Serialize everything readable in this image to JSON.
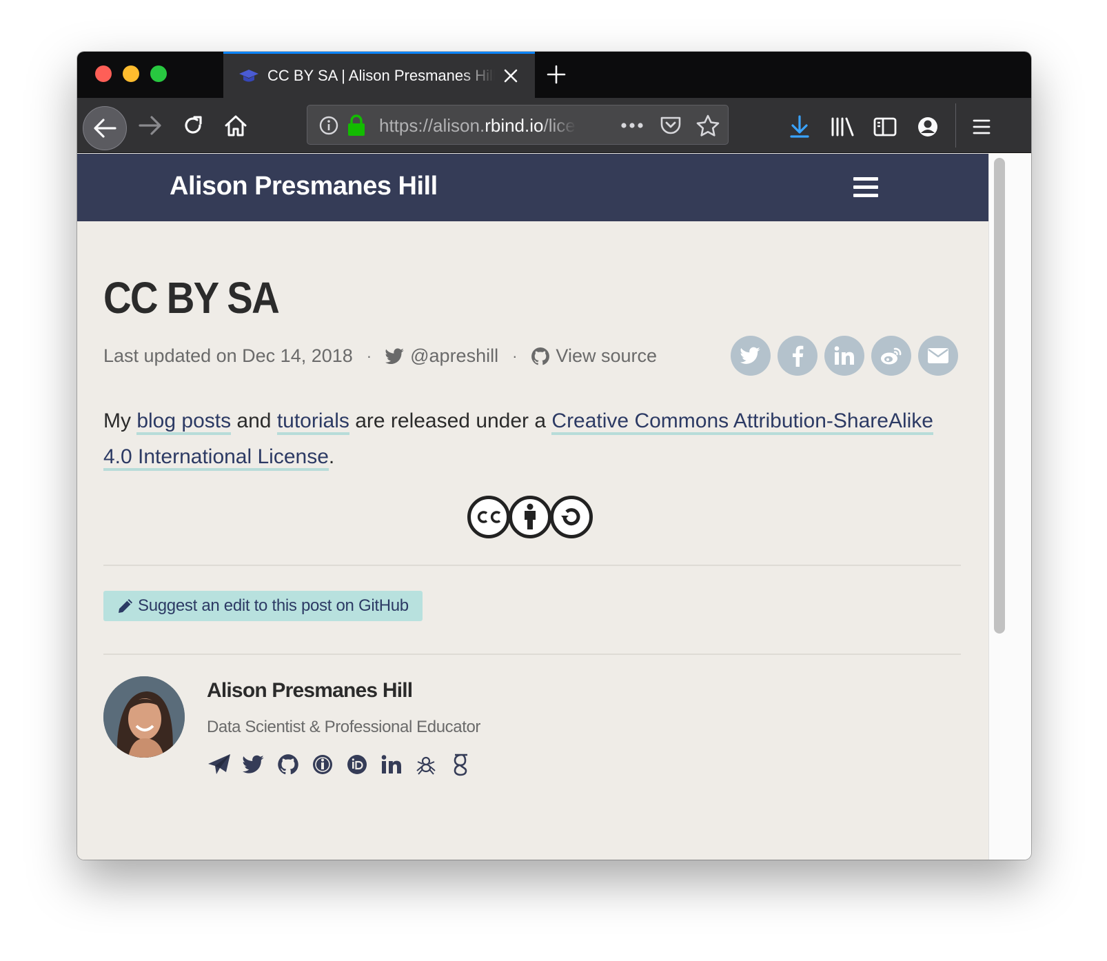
{
  "browser": {
    "tab_title": "CC BY SA | Alison Presmanes Hill",
    "url_scheme": "https://alison.",
    "url_host": "rbind.io",
    "url_rest": "/license/",
    "icons": {
      "back": "arrow-left-icon",
      "forward": "arrow-right-icon",
      "reload": "reload-icon",
      "home": "home-icon",
      "info": "info-icon",
      "lock": "lock-icon",
      "more": "ellipsis-icon",
      "pocket": "pocket-icon",
      "bookmark": "star-icon",
      "download": "download-icon",
      "library": "library-icon",
      "sidebar": "sidebar-icon",
      "account": "account-icon",
      "menu": "hamburger-icon"
    },
    "colors": {
      "tab_accent": "#0a84ff",
      "toolbar": "#323234",
      "tabstrip": "#0c0c0d",
      "download_icon": "#3aa3ff"
    }
  },
  "site": {
    "title": "Alison Presmanes Hill",
    "header_color": "#353c57"
  },
  "post": {
    "title": "CC BY SA",
    "last_updated": "Last updated on Dec 14, 2018",
    "twitter_handle": "@apreshill",
    "view_source": "View source",
    "share_icons": [
      "twitter-icon",
      "facebook-icon",
      "linkedin-icon",
      "weibo-icon",
      "email-icon"
    ],
    "body": {
      "part1": "My ",
      "link_blog": "blog posts",
      "part2": " and ",
      "link_tutorials": "tutorials",
      "part3": " are released under a ",
      "link_license": "Creative Commons Attribution-ShareAlike 4.0 International License",
      "part4": "."
    },
    "badge_icons": [
      "cc-icon",
      "by-icon",
      "sa-icon"
    ],
    "edit_label": "Suggest an edit to this post on GitHub"
  },
  "author": {
    "name": "Alison Presmanes Hill",
    "role": "Data Scientist & Professional Educator",
    "links": [
      "paper-plane-icon",
      "twitter-icon",
      "github-icon",
      "impactstory-icon",
      "orcid-icon",
      "linkedin-icon",
      "spider-icon",
      "google-scholar-icon"
    ]
  }
}
